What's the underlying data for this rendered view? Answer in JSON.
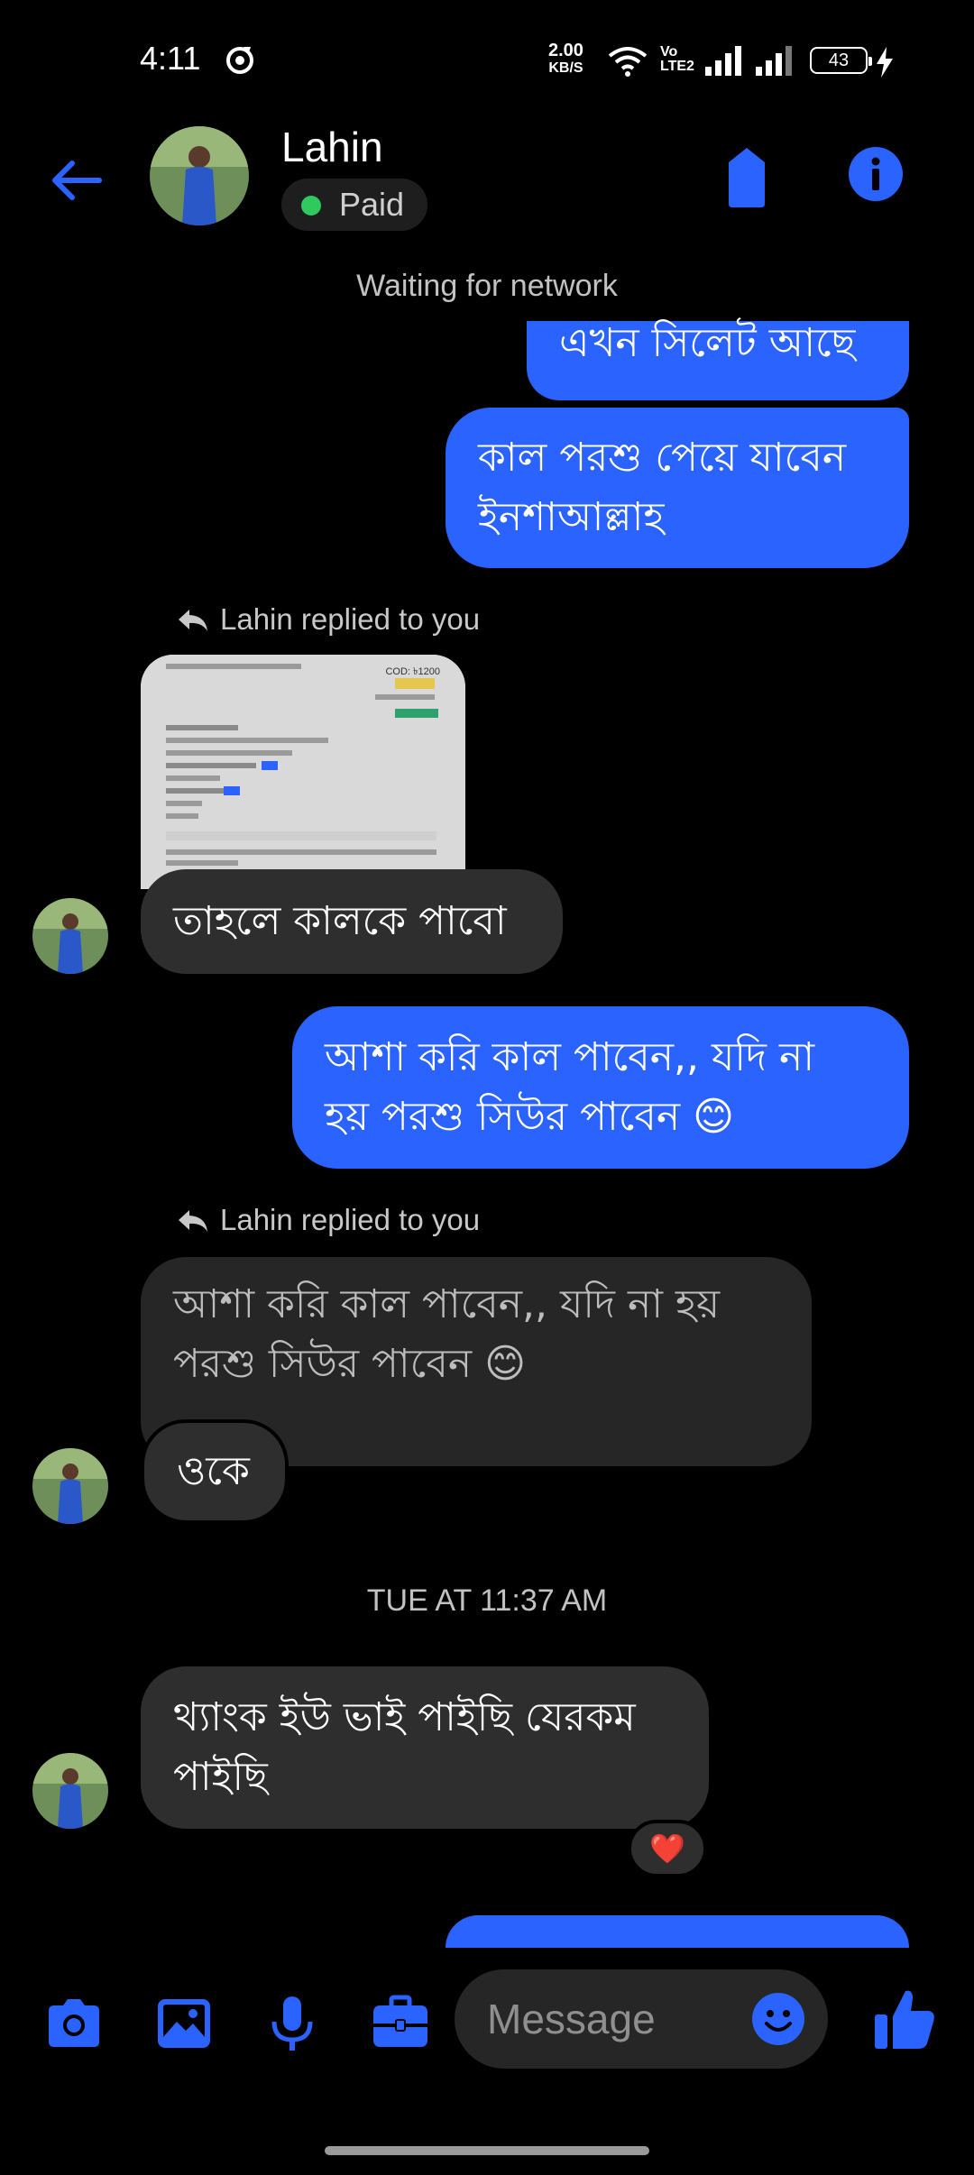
{
  "status_bar": {
    "time": "4:11",
    "net_speed_value": "2.00",
    "net_speed_unit": "KB/S",
    "volte_top": "Vo",
    "volte_bottom": "LTE2",
    "battery": "43"
  },
  "header": {
    "contact_name": "Lahin",
    "status_label": "Paid",
    "accent_color": "#2a63ff",
    "status_dot_color": "#30c95f"
  },
  "notice": "Waiting for network",
  "messages": [
    {
      "id": "m1",
      "direction": "outgoing",
      "text": "এখন সিলেট আছে"
    },
    {
      "id": "m2",
      "direction": "outgoing",
      "lines": [
        "কাল পরশু পেয়ে যাবেন",
        "ইনশাআল্লাহ"
      ]
    },
    {
      "id": "m3",
      "direction": "incoming",
      "reply_label": "Lahin replied to you",
      "quoted": "image",
      "text": "তাহলে কালকে পাবো"
    },
    {
      "id": "m4",
      "direction": "outgoing",
      "lines": [
        "আশা করি কাল পাবেন,, যদি না",
        "হয় পরশু সিউর পাবেন 😊"
      ]
    },
    {
      "id": "m5",
      "direction": "incoming",
      "reply_label": "Lahin replied to you",
      "quoted_lines": [
        "আশা করি কাল পাবেন,, যদি না হয়",
        "পরশু সিউর পাবেন 😊"
      ],
      "text": "ওকে"
    },
    {
      "id": "m6",
      "direction": "incoming",
      "lines": [
        "থ্যাংক ইউ ভাই পাইছি যেরকম",
        "পাইছি"
      ],
      "reaction": "❤️"
    }
  ],
  "timestamp": "TUE AT 11:37 AM",
  "attachment": {
    "price_label": "COD: ৳1200"
  },
  "composer": {
    "placeholder": "Message",
    "icons": [
      "camera-icon",
      "gallery-icon",
      "microphone-icon",
      "briefcase-icon",
      "emoji-icon",
      "thumbs-up-icon"
    ]
  }
}
